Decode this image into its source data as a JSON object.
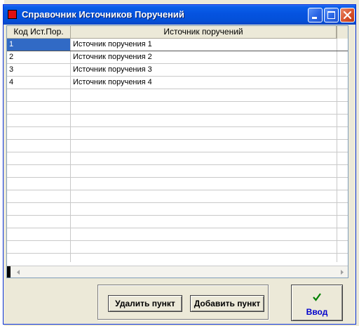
{
  "window": {
    "title": "Справочник Источников Поручений"
  },
  "grid": {
    "columns": [
      "Код Ист.Пор.",
      "Источник поручений"
    ],
    "rows": [
      {
        "code": "1",
        "name": "Источник поручения 1"
      },
      {
        "code": "2",
        "name": "Источник поручения 2"
      },
      {
        "code": "3",
        "name": "Источник поручения 3"
      },
      {
        "code": "4",
        "name": "Источник поручения 4"
      }
    ],
    "selected_row": 0
  },
  "buttons": {
    "delete_label": "Удалить пункт",
    "add_label": "Добавить пункт",
    "enter_label": "Ввод"
  },
  "icons": {
    "title": "app-icon",
    "minimize": "minimize-icon",
    "maximize": "maximize-icon",
    "close": "close-icon",
    "enter": "checkmark-icon"
  },
  "colors": {
    "titlebar": "#0553e0",
    "close_button": "#d8532d",
    "enter_label": "#0000cc",
    "checkmark": "#008000"
  }
}
